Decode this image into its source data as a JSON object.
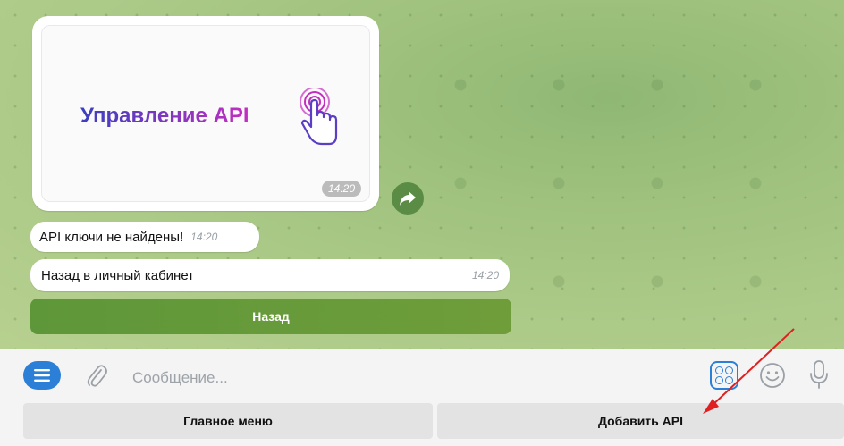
{
  "chat": {
    "image_message": {
      "banner_text": "Управление API",
      "time": "14:20"
    },
    "messages": [
      {
        "text": "API ключи не найдены!",
        "time": "14:20"
      },
      {
        "text": "Назад в личный кабинет",
        "time": "14:20"
      }
    ],
    "inline_button_label": "Назад"
  },
  "composer": {
    "placeholder": "Сообщение..."
  },
  "keyboard": {
    "buttons": [
      "Главное меню",
      "Добавить API"
    ]
  },
  "colors": {
    "accent": "#2b7fd6",
    "inline_button": "#6a9a3b",
    "annotation_arrow": "#e02020"
  },
  "icons": [
    "menu-icon",
    "paperclip-icon",
    "keyboard-toggle-icon",
    "emoji-icon",
    "microphone-icon",
    "forward-icon",
    "pointer-hand-icon"
  ]
}
